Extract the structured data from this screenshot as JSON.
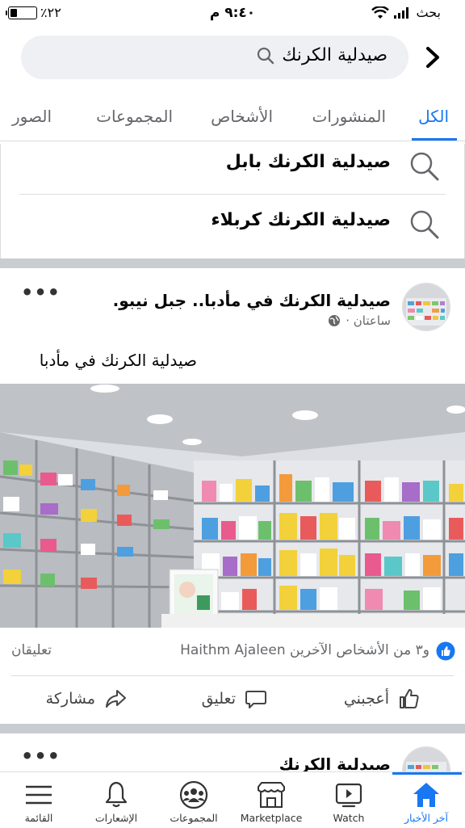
{
  "status_bar": {
    "carrier": "بحث",
    "time": "٩:٤٠ م",
    "battery": "٪٢٢"
  },
  "search": {
    "query": "صيدلية الكرنك"
  },
  "tabs": [
    {
      "label": "الكل",
      "active": true
    },
    {
      "label": "المنشورات"
    },
    {
      "label": "الأشخاص"
    },
    {
      "label": "المجموعات"
    },
    {
      "label": "الصور"
    }
  ],
  "suggestions": [
    {
      "label": "صيدلية الكرنك بابل"
    },
    {
      "label": "صيدلية الكرنك كربلاء"
    }
  ],
  "post": {
    "page_name": "صيدلية الكرنك في مأدبا.. جبل نيبو.",
    "time": "ساعتان ·",
    "text": "صيدلية الكرنك في مأدبا",
    "reactions": "Haithm Ajaleen و٣ من الأشخاص الآخرين",
    "comments": "تعليقان",
    "actions": {
      "like": "أعجبني",
      "comment": "تعليق",
      "share": "مشاركة"
    }
  },
  "next_post": {
    "page_name": "صيدلية الكرنك"
  },
  "bottom_nav": [
    {
      "label": "آخر الأخبار",
      "icon": "home-icon",
      "active": true
    },
    {
      "label": "Watch",
      "icon": "watch-icon"
    },
    {
      "label": "Marketplace",
      "icon": "marketplace-icon"
    },
    {
      "label": "المجموعات",
      "icon": "groups-icon"
    },
    {
      "label": "الإشعارات",
      "icon": "bell-icon"
    },
    {
      "label": "القائمة",
      "icon": "menu-icon"
    }
  ],
  "colors": {
    "accent": "#1877f2",
    "search_bg": "#eef0f3",
    "separator": "#c9ccd1"
  }
}
